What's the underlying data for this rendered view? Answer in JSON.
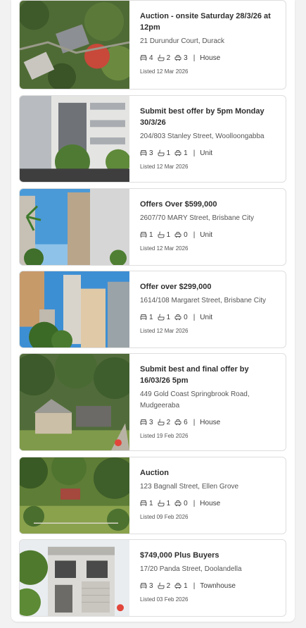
{
  "listings": [
    {
      "headline": "Auction - onsite Saturday 28/3/26 at 12pm",
      "address": "21 Durundur Court, Durack",
      "beds": "4",
      "baths": "2",
      "parking": "3",
      "type": "House",
      "listed": "Listed 12 Mar 2026"
    },
    {
      "headline": "Submit best offer by 5pm Monday 30/3/26",
      "address": "204/803 Stanley Street, Woolloongabba",
      "beds": "3",
      "baths": "1",
      "parking": "1",
      "type": "Unit",
      "listed": "Listed 12 Mar 2026"
    },
    {
      "headline": "Offers Over $599,000",
      "address": "2607/70 MARY Street, Brisbane City",
      "beds": "1",
      "baths": "1",
      "parking": "0",
      "type": "Unit",
      "listed": "Listed 12 Mar 2026"
    },
    {
      "headline": "Offer over $299,000",
      "address": "1614/108 Margaret Street, Brisbane City",
      "beds": "1",
      "baths": "1",
      "parking": "0",
      "type": "Unit",
      "listed": "Listed 12 Mar 2026"
    },
    {
      "headline": "Submit best and final offer by 16/03/26 5pm",
      "address": "449 Gold Coast Springbrook Road, Mudgeeraba",
      "beds": "3",
      "baths": "2",
      "parking": "6",
      "type": "House",
      "listed": "Listed 19 Feb 2026"
    },
    {
      "headline": "Auction",
      "address": "123 Bagnall Street, Ellen Grove",
      "beds": "1",
      "baths": "1",
      "parking": "0",
      "type": "House",
      "listed": "Listed 09 Feb 2026"
    },
    {
      "headline": "$749,000 Plus Buyers",
      "address": "17/20 Panda Street, Doolandella",
      "beds": "3",
      "baths": "2",
      "parking": "1",
      "type": "Townhouse",
      "listed": "Listed 03 Feb 2026"
    }
  ],
  "separator": "|",
  "icons": {
    "beds": "bed-icon",
    "baths": "bath-icon",
    "parking": "car-icon"
  },
  "colors": {
    "headline": "#2e2e2e",
    "text": "#555555",
    "border": "#dedede"
  }
}
